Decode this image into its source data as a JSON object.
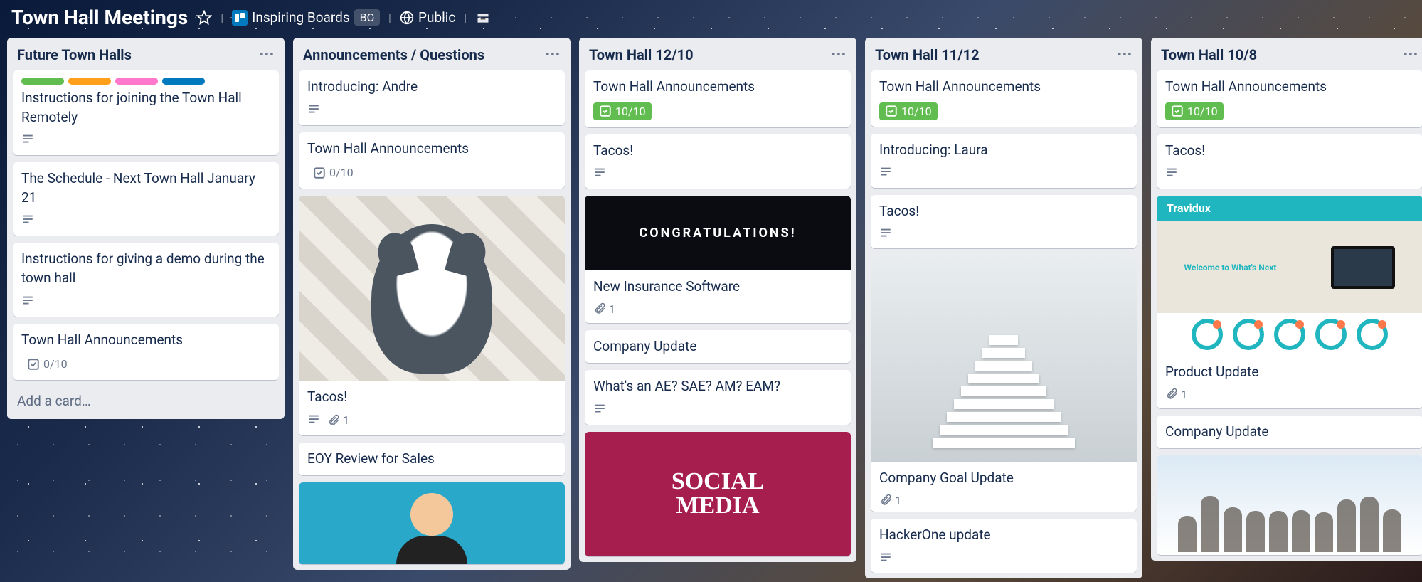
{
  "header": {
    "title": "Town Hall Meetings",
    "workspace": "Inspiring Boards",
    "workspace_badge": "BC",
    "visibility": "Public"
  },
  "icons": {
    "star": "star-icon",
    "globe": "globe-icon",
    "drawer": "drawer-icon"
  },
  "add_card_label": "Add a card…",
  "covers": {
    "congratulations": "CONGRATULATIONS!",
    "social": "SOCIAL MEDIA",
    "travidux": "Travidux",
    "travidux_welcome": "Welcome to What's Next"
  },
  "lists": [
    {
      "title": "Future Town Halls",
      "cards": [
        {
          "title": "Instructions for joining the Town Hall Remotely",
          "labels": [
            "green",
            "orange",
            "pink",
            "blue"
          ],
          "desc": true
        },
        {
          "title": "The Schedule - Next Town Hall January 21",
          "desc": true
        },
        {
          "title": "Instructions for giving a demo during the town hall",
          "desc": true
        },
        {
          "title": "Town Hall Announcements",
          "checklist": "0/10",
          "done": false
        }
      ],
      "show_add": true
    },
    {
      "title": "Announcements / Questions",
      "cards": [
        {
          "title": "Introducing: Andre",
          "desc": true
        },
        {
          "title": "Town Hall Announcements",
          "checklist": "0/10",
          "done": false
        },
        {
          "title": "Tacos!",
          "desc": true,
          "attach": "1",
          "cover": "husky"
        },
        {
          "title": "EOY Review for Sales"
        },
        {
          "title": "",
          "cover": "person",
          "cover_only": true
        }
      ]
    },
    {
      "title": "Town Hall 12/10",
      "cards": [
        {
          "title": "Town Hall Announcements",
          "checklist": "10/10",
          "done": true
        },
        {
          "title": "Tacos!",
          "desc": true
        },
        {
          "title": "New Insurance Software",
          "attach": "1",
          "cover": "confetti"
        },
        {
          "title": "Company Update"
        },
        {
          "title": "What's an AE? SAE? AM? EAM?",
          "desc": true
        },
        {
          "title": "",
          "cover": "social",
          "cover_only": true
        }
      ]
    },
    {
      "title": "Town Hall 11/12",
      "cards": [
        {
          "title": "Town Hall Announcements",
          "checklist": "10/10",
          "done": true
        },
        {
          "title": "Introducing: Laura",
          "desc": true
        },
        {
          "title": "Tacos!",
          "desc": true
        },
        {
          "title": "Company Goal Update",
          "attach": "1",
          "cover": "stairs"
        },
        {
          "title": "HackerOne update",
          "desc": true
        }
      ]
    },
    {
      "title": "Town Hall 10/8",
      "cards": [
        {
          "title": "Town Hall Announcements",
          "checklist": "10/10",
          "done": true
        },
        {
          "title": "Tacos!",
          "desc": true
        },
        {
          "title": "Product Update",
          "attach": "1",
          "cover": "travidux"
        },
        {
          "title": "Company Update"
        },
        {
          "title": "",
          "cover": "people",
          "cover_only": true
        }
      ]
    }
  ]
}
